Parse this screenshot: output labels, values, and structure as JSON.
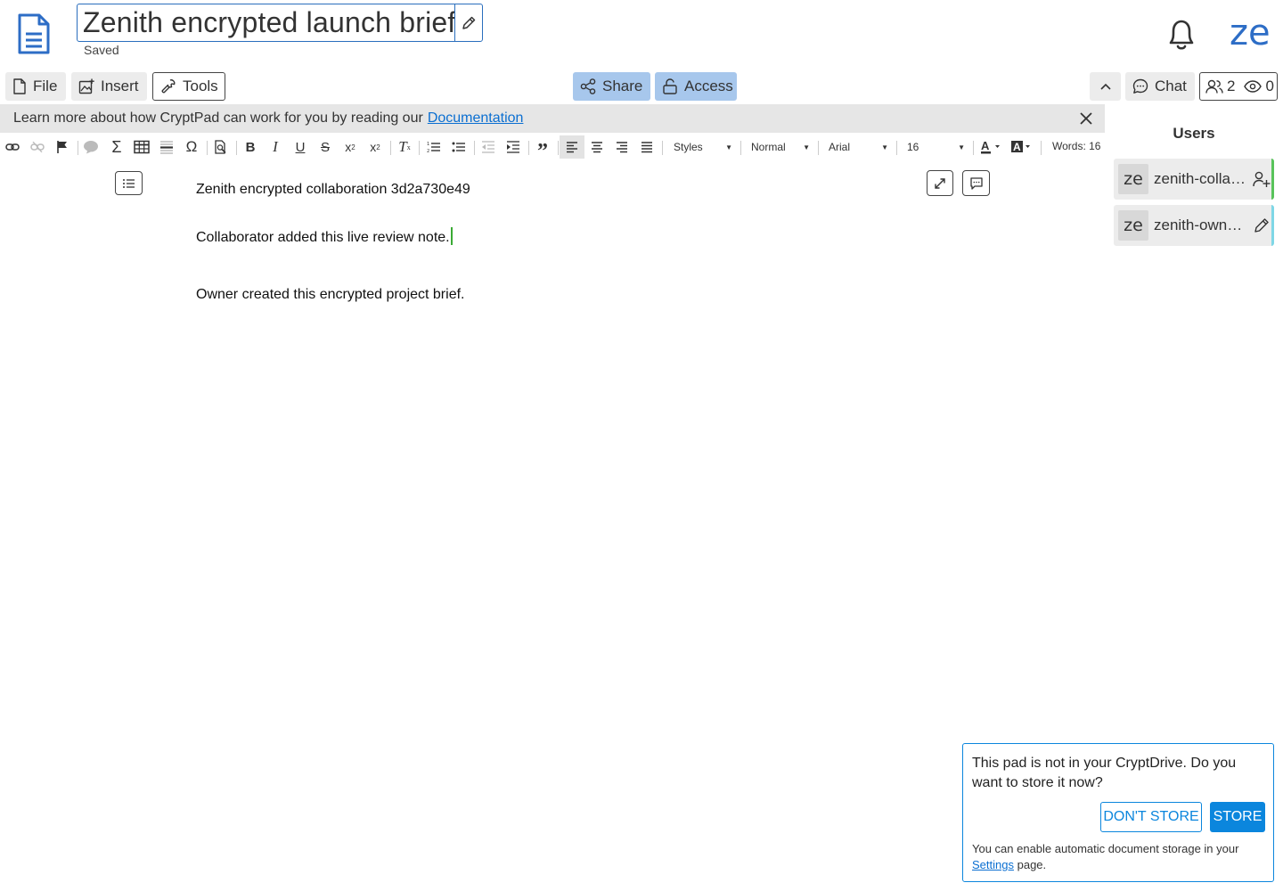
{
  "header": {
    "doc_title": "Zenith encrypted launch brief",
    "save_status": "Saved",
    "user_avatar": "ze"
  },
  "toolbar": {
    "file": "File",
    "insert": "Insert",
    "tools": "Tools",
    "share": "Share",
    "access": "Access",
    "chat": "Chat",
    "users_count": "2",
    "viewers_count": "0"
  },
  "infobar": {
    "text": "Learn more about how CryptPad can work for you by reading our",
    "link": "Documentation"
  },
  "editor_toolbar": {
    "styles": "Styles",
    "format": "Normal",
    "font": "Arial",
    "size": "16",
    "word_count": "Words: 16"
  },
  "document": {
    "paragraphs": [
      "Zenith encrypted collaboration 3d2a730e49",
      "Collaborator added this live review note.",
      "Owner created this encrypted project brief."
    ]
  },
  "users_panel": {
    "title": "Users",
    "users": [
      {
        "avatar": "ze",
        "name": "zenith-collaborator",
        "display": "zenith-colla…",
        "icon": "add-user-icon",
        "color": "#59c35b"
      },
      {
        "avatar": "ze",
        "name": "zenith-owner",
        "display": "zenith-owne…",
        "icon": "pencil-icon",
        "color": "#7fd7e6"
      }
    ]
  },
  "store_popup": {
    "message": "This pad is not in your CryptDrive. Do you want to store it now?",
    "dont_store": "DON'T STORE",
    "store": "STORE",
    "hint_prefix": "You can enable automatic document storage in your",
    "hint_link": "Settings",
    "hint_suffix": "page."
  },
  "colors": {
    "accent": "#0b86dd",
    "share_bg": "#a7c7ec",
    "link": "#0b6fd1",
    "avatar_text": "#2d6dc6"
  }
}
